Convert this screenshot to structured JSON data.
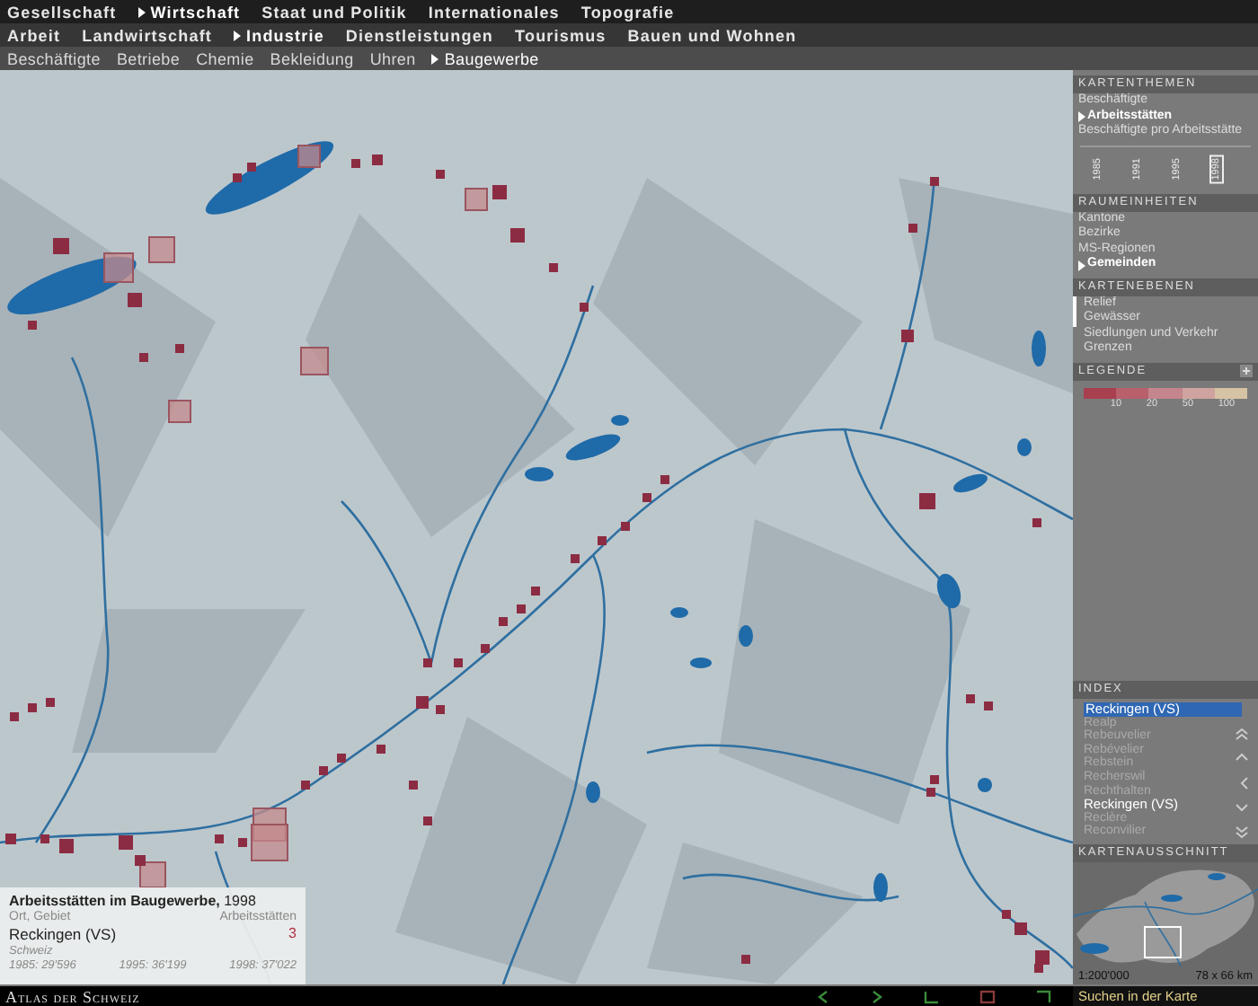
{
  "menus": [
    {
      "items": [
        {
          "label": "Gesellschaft",
          "selected": false
        },
        {
          "label": "Wirtschaft",
          "selected": true
        },
        {
          "label": "Staat und Politik",
          "selected": false
        },
        {
          "label": "Internationales",
          "selected": false
        },
        {
          "label": "Topografie",
          "selected": false
        }
      ]
    },
    {
      "items": [
        {
          "label": "Arbeit",
          "selected": false
        },
        {
          "label": "Landwirtschaft",
          "selected": false
        },
        {
          "label": "Industrie",
          "selected": true
        },
        {
          "label": "Dienstleistungen",
          "selected": false
        },
        {
          "label": "Tourismus",
          "selected": false
        },
        {
          "label": "Bauen und Wohnen",
          "selected": false
        }
      ]
    },
    {
      "items": [
        {
          "label": "Beschäftigte",
          "selected": false
        },
        {
          "label": "Betriebe",
          "selected": false
        },
        {
          "label": "Chemie",
          "selected": false
        },
        {
          "label": "Bekleidung",
          "selected": false
        },
        {
          "label": "Uhren",
          "selected": false
        },
        {
          "label": "Baugewerbe",
          "selected": true
        }
      ]
    }
  ],
  "info": {
    "title": "**Arbeitsstätten im Baugewerbe,** 1998",
    "col_place": "Ort, Gebiet",
    "col_value": "Arbeitsstätten",
    "place": "Reckingen (VS)",
    "value": "3",
    "region": "Schweiz",
    "history": [
      "1985: 29'596",
      "1995: 36'199",
      "1998: 37'022"
    ]
  },
  "kartenthemen": {
    "title": "KARTENTHEMEN",
    "items": [
      {
        "label": "Beschäftigte",
        "selected": false
      },
      {
        "label": "Arbeitsstätten",
        "selected": true
      },
      {
        "label": "Beschäftigte pro Arbeitsstätte",
        "selected": false
      }
    ],
    "years": [
      {
        "label": "1985",
        "selected": false
      },
      {
        "label": "1991",
        "selected": false
      },
      {
        "label": "1995",
        "selected": false
      },
      {
        "label": "1998",
        "selected": true
      }
    ]
  },
  "raumeinheiten": {
    "title": "RAUMEINHEITEN",
    "items": [
      {
        "label": "Kantone",
        "selected": false
      },
      {
        "label": "Bezirke",
        "selected": false
      },
      {
        "label": "MS-Regionen",
        "selected": false
      },
      {
        "label": "Gemeinden",
        "selected": true
      }
    ]
  },
  "kartenebenen": {
    "title": "KARTENEBENEN",
    "items": [
      {
        "label": "Relief",
        "on": true
      },
      {
        "label": "Gewässer",
        "on": true
      },
      {
        "label": "Siedlungen und Verkehr",
        "on": false
      },
      {
        "label": "Grenzen",
        "on": false
      }
    ]
  },
  "legende": {
    "title": "LEGENDE",
    "swatches": [
      {
        "color": "#a8404f"
      },
      {
        "color": "#b8606c"
      },
      {
        "color": "#c4858c"
      },
      {
        "color": "#cfa39f"
      },
      {
        "color": "#d6c3a4"
      }
    ],
    "ticks": [
      "10",
      "20",
      "50",
      "100"
    ]
  },
  "index": {
    "title": "INDEX",
    "search": {
      "value": "Reckingen (VS)"
    },
    "items": [
      {
        "label": "Realp",
        "selected": false
      },
      {
        "label": "Rebeuvelier",
        "selected": false
      },
      {
        "label": "Rebévelier",
        "selected": false
      },
      {
        "label": "Rebstein",
        "selected": false
      },
      {
        "label": "Recherswil",
        "selected": false
      },
      {
        "label": "Rechthalten",
        "selected": false
      },
      {
        "label": "Reckingen (VS)",
        "selected": true
      },
      {
        "label": "Reclère",
        "selected": false
      },
      {
        "label": "Reconvilier",
        "selected": false
      }
    ]
  },
  "kartenausschnitt": {
    "title": "KARTENAUSSCHNITT",
    "scale": "1:200'000",
    "extent": "78 x 66 km"
  },
  "status_bar": {
    "brand": "Atlas der Schweiz",
    "search_label": "Suchen in der Karte"
  }
}
